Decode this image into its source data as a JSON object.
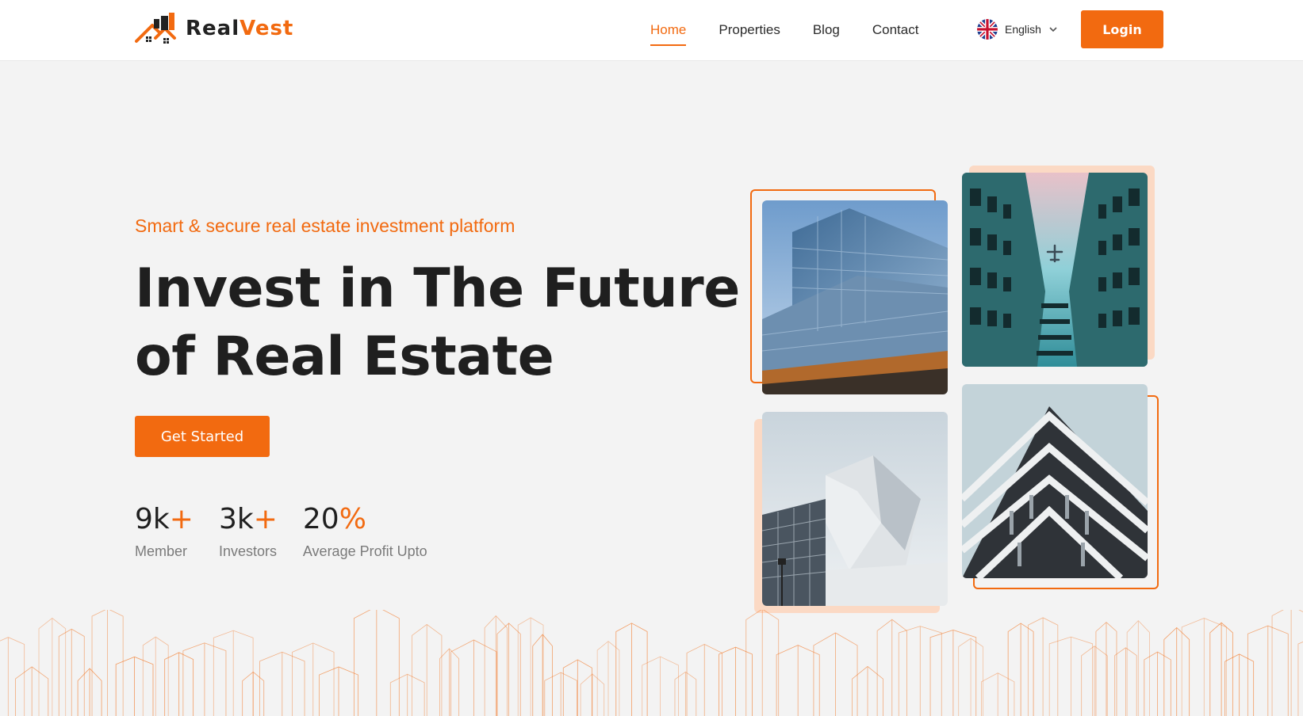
{
  "brand": {
    "name_part1": "Real",
    "name_part2": "Vest",
    "accent": "#f26a10"
  },
  "nav": {
    "items": [
      {
        "label": "Home",
        "active": true
      },
      {
        "label": "Properties",
        "active": false
      },
      {
        "label": "Blog",
        "active": false
      },
      {
        "label": "Contact",
        "active": false
      }
    ]
  },
  "language": {
    "label": "English",
    "flag": "uk-flag-icon"
  },
  "header": {
    "login_label": "Login"
  },
  "hero": {
    "tagline": "Smart & secure real estate investment platform",
    "headline_line1": "Invest in The Future",
    "headline_line2": "of Real Estate",
    "cta_label": "Get Started",
    "stats": [
      {
        "value": "9k",
        "suffix": "+",
        "label": "Member"
      },
      {
        "value": "3k",
        "suffix": "+",
        "label": "Investors"
      },
      {
        "value": "20",
        "suffix": "%",
        "label": "Average Profit Upto"
      }
    ]
  },
  "gallery": {
    "images": [
      {
        "name": "glass-office-building-photo"
      },
      {
        "name": "upward-facade-airplane-photo"
      },
      {
        "name": "modern-angular-building-photo"
      },
      {
        "name": "triangular-balcony-building-photo"
      }
    ]
  },
  "colors": {
    "accent": "#f26a10",
    "accent_light": "#fbd9c4",
    "text": "#1f1f1f",
    "muted": "#7a7a7a",
    "background": "#f3f3f3"
  }
}
